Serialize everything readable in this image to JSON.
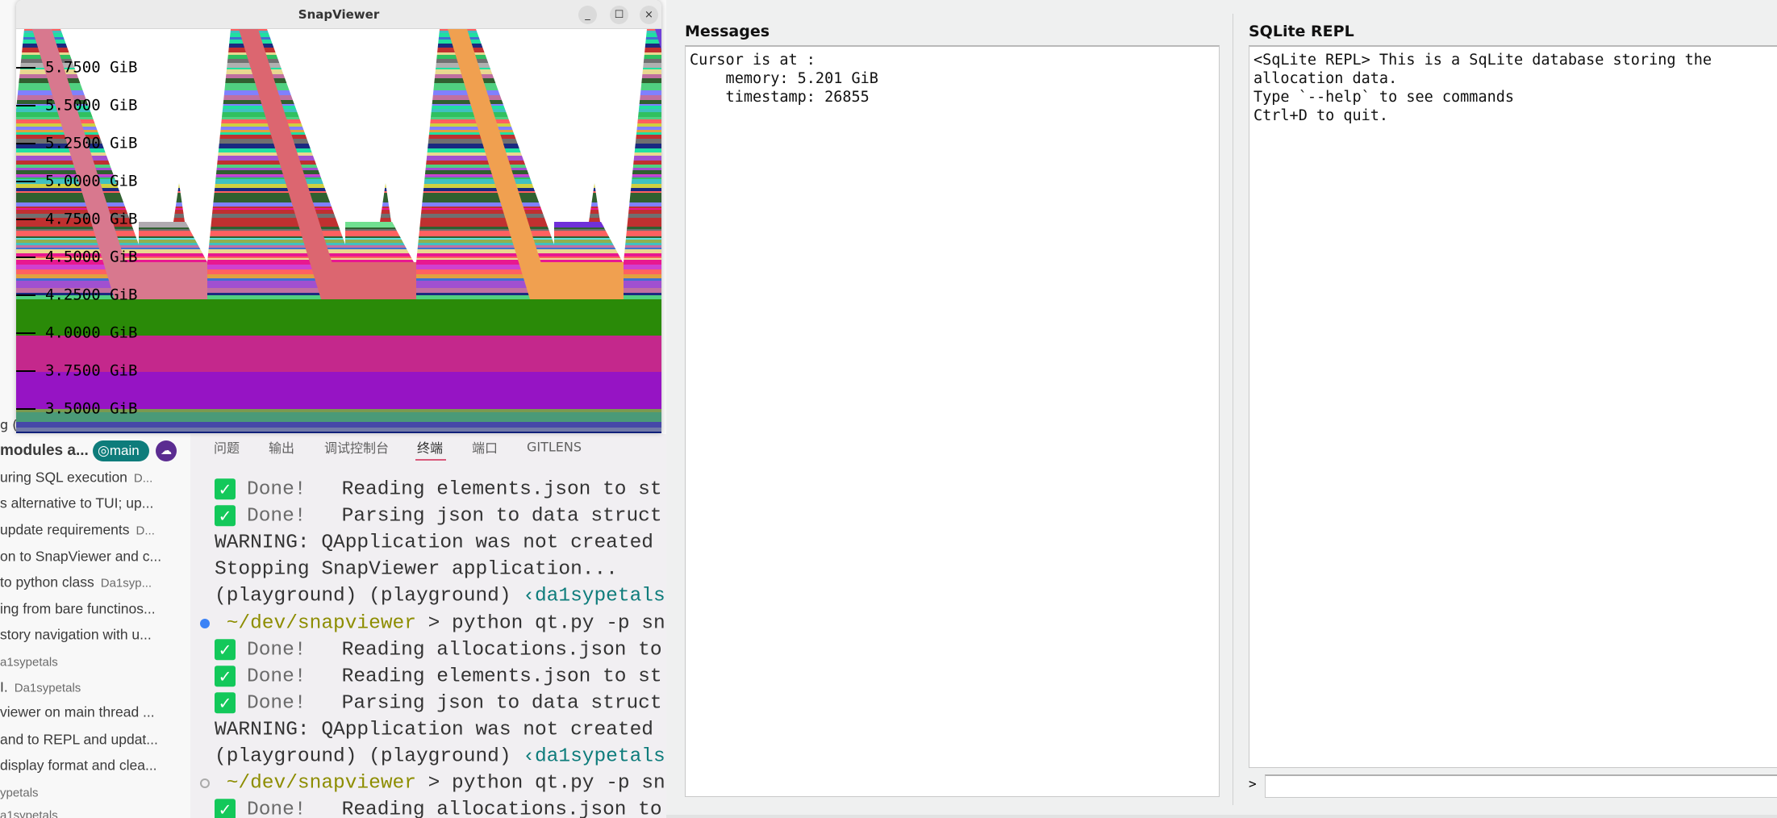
{
  "snapviewer": {
    "title": "SnapViewer",
    "min": "_",
    "max": "☐",
    "close": "×",
    "y_ticks": [
      {
        "value": 5.75,
        "label": "5.7500 GiB"
      },
      {
        "value": 5.5,
        "label": "5.5000 GiB"
      },
      {
        "value": 5.25,
        "label": "5.2500 GiB"
      },
      {
        "value": 5.0,
        "label": "5.0000 GiB"
      },
      {
        "value": 4.75,
        "label": "4.7500 GiB"
      },
      {
        "value": 4.5,
        "label": "4.5000 GiB"
      },
      {
        "value": 4.25,
        "label": "4.2500 GiB"
      },
      {
        "value": 4.0,
        "label": "4.0000 GiB"
      },
      {
        "value": 3.75,
        "label": "3.7500 GiB"
      },
      {
        "value": 3.5,
        "label": "3.5000 GiB"
      }
    ],
    "colors": {
      "green_band": "#2a8a08",
      "magenta_band": "#c4288c",
      "purple_band": "#9614c4",
      "slopes": [
        "#d8788e",
        "#dc6670",
        "#f0a050",
        "#7040d8"
      ]
    }
  },
  "sidebar": {
    "clipped": "g  (",
    "header": "modules a...",
    "branch": "main",
    "cloud_icon": "cloud-icon",
    "items": [
      {
        "text": "uring SQL execution",
        "author": "D..."
      },
      {
        "text": "s alternative to TUI; up...",
        "author": ""
      },
      {
        "text": "update requirements",
        "author": "D..."
      },
      {
        "text": "on to SnapViewer and c...",
        "author": ""
      },
      {
        "text": "to python class",
        "author": "Da1syp..."
      },
      {
        "text": "ing from bare functinos...",
        "author": ""
      },
      {
        "text": "story navigation with u...",
        "author": ""
      },
      {
        "text": "",
        "author": "a1sypetals"
      },
      {
        "text": "I.",
        "author": "Da1sypetals"
      },
      {
        "text": "viewer on main thread ...",
        "author": ""
      },
      {
        "text": "and to REPL and updat...",
        "author": ""
      },
      {
        "text": "display format and clea...",
        "author": ""
      },
      {
        "text": "",
        "author": "ypetals"
      },
      {
        "text": "",
        "author": "a1sypetals"
      }
    ]
  },
  "panel": {
    "tabs": [
      "问题",
      "输出",
      "调试控制台",
      "终端",
      "端口",
      "GITLENS"
    ],
    "active_tab": "终端",
    "lines": [
      {
        "kind": "done",
        "done": "Done!",
        "text": "Reading elements.json to st"
      },
      {
        "kind": "done",
        "done": "Done!",
        "text": "Parsing json to data struct"
      },
      {
        "kind": "plain",
        "text": "WARNING: QApplication was not created"
      },
      {
        "kind": "plain",
        "text": "Stopping SnapViewer application..."
      },
      {
        "kind": "venv",
        "text": "(playground) (playground) ",
        "user": "‹da1sypetals"
      },
      {
        "kind": "prompt",
        "dot": "blue",
        "path": "~/dev/snapviewer",
        "text": " > python qt.py -p sn"
      },
      {
        "kind": "done",
        "done": "Done!",
        "text": "Reading allocations.json to"
      },
      {
        "kind": "done",
        "done": "Done!",
        "text": "Reading elements.json to st"
      },
      {
        "kind": "done",
        "done": "Done!",
        "text": "Parsing json to data struct"
      },
      {
        "kind": "plain",
        "text": "WARNING: QApplication was not created"
      },
      {
        "kind": "venv",
        "text": "(playground) (playground) ",
        "user": "‹da1sypetals"
      },
      {
        "kind": "prompt",
        "dot": "hollow",
        "path": "~/dev/snapviewer",
        "text": " > python qt.py -p sn"
      },
      {
        "kind": "done",
        "done": "Done!",
        "text": "Reading allocations.json to"
      }
    ]
  },
  "messages": {
    "title": "Messages",
    "lines": [
      "Cursor is at :",
      "    memory: 5.201 GiB",
      "    timestamp: 26855"
    ]
  },
  "repl": {
    "title": "SQLite REPL",
    "lines": [
      "<SqLite REPL> This is a SqLite database storing the",
      "allocation data.",
      "Type `--help` to see commands",
      "Ctrl+D to quit."
    ],
    "prompt": ">",
    "input_value": ""
  }
}
